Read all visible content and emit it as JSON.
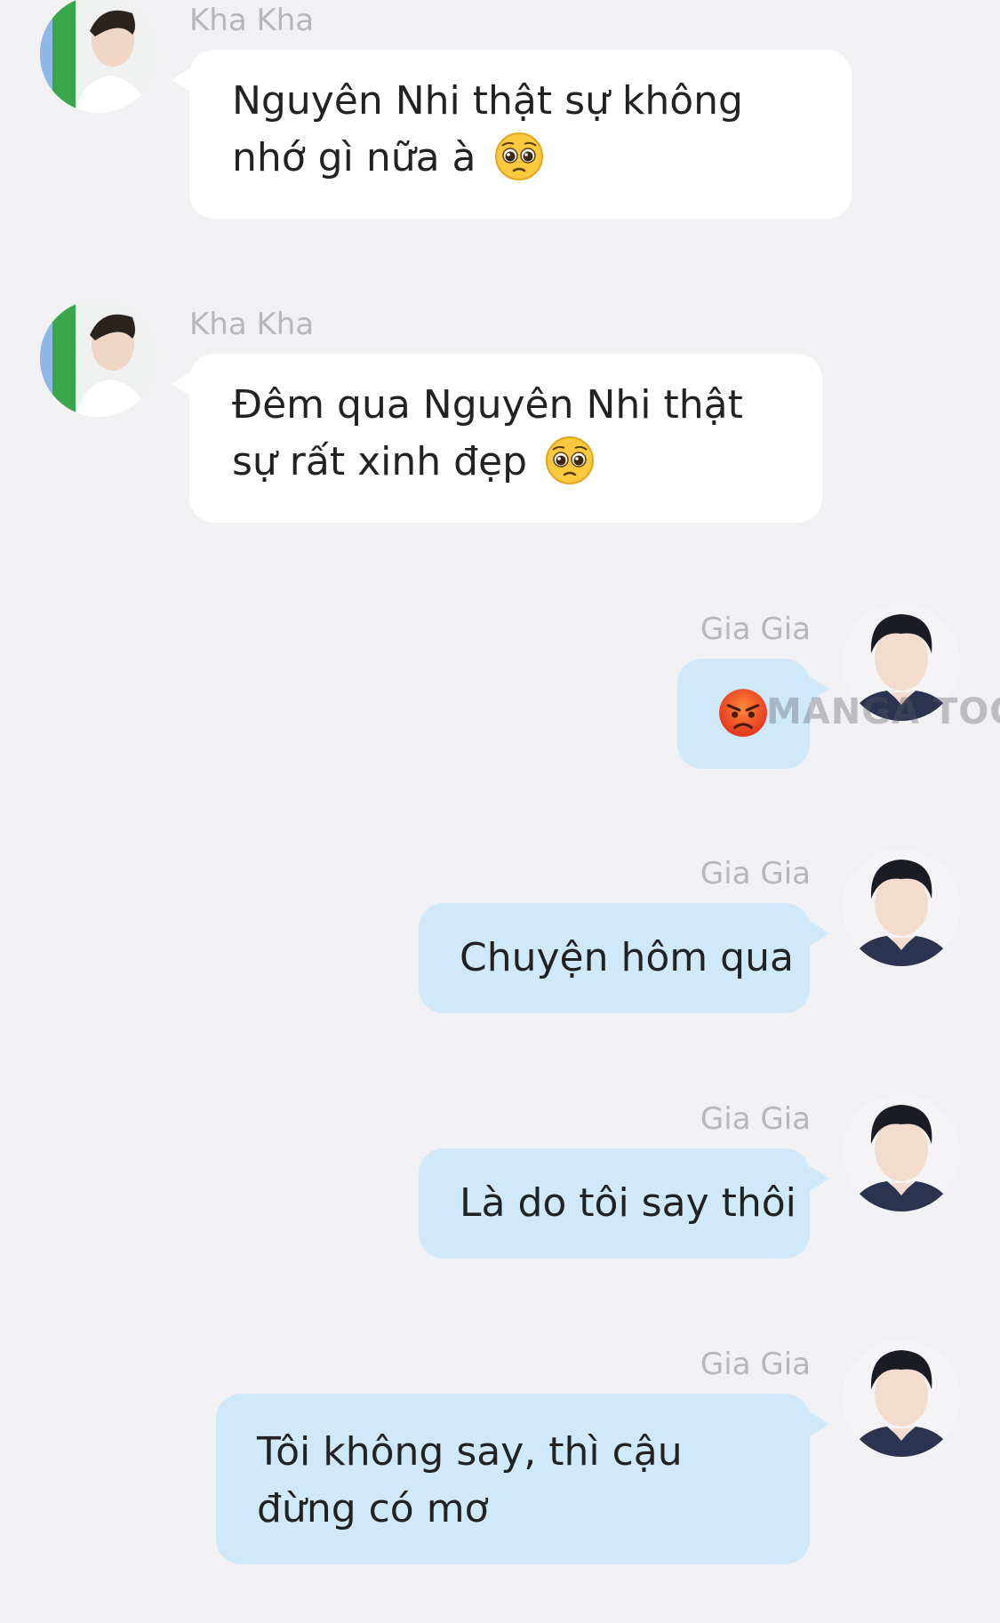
{
  "colors": {
    "background": "#f1f1f3",
    "incoming_bubble": "#ffffff",
    "outgoing_bubble": "#cfe9fb",
    "sender_name": "#b7b7bb",
    "message_text": "#222222"
  },
  "messages": [
    {
      "direction": "incoming",
      "sender": "Kha Kha",
      "text": "Nguyên Nhi thật sự không nhớ gì nữa à",
      "emoji": "pleading-face-emoji"
    },
    {
      "direction": "incoming",
      "sender": "Kha Kha",
      "text": "Đêm qua Nguyên Nhi thật sự rất xinh đẹp",
      "emoji": "pleading-face-emoji"
    },
    {
      "direction": "outgoing",
      "sender": "Gia Gia",
      "text": "",
      "emoji": "angry-face-emoji"
    },
    {
      "direction": "outgoing",
      "sender": "Gia Gia",
      "text": "Chuyện hôm qua"
    },
    {
      "direction": "outgoing",
      "sender": "Gia Gia",
      "text": "Là do tôi say thôi"
    },
    {
      "direction": "outgoing",
      "sender": "Gia Gia",
      "text": "Tôi không say, thì cậu đừng có mơ"
    }
  ],
  "watermark": {
    "text": "MANGA TOON"
  }
}
